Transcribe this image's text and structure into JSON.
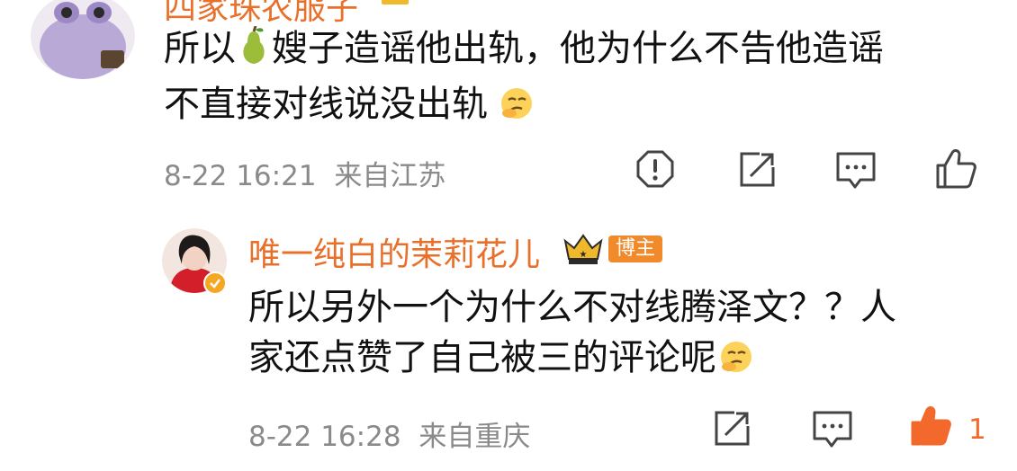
{
  "comment1": {
    "username": "四家珠农服子",
    "text_line1_a": "所以",
    "text_line1_b": "嫂子造谣他出轨，他为什么不告他造谣",
    "text_line2": "不直接对线说没出轨",
    "time": "8-22 16:21",
    "location": "来自江苏"
  },
  "reply": {
    "username": "唯一纯白的茉莉花儿",
    "badge": "博主",
    "text_line1": "所以另外一个为什么不对线腾泽文？？人",
    "text_line2": "家还点赞了自己被三的评论呢",
    "time": "8-22 16:28",
    "location": "来自重庆",
    "like_count": "1"
  },
  "colors": {
    "accent": "#e8702a",
    "meta": "#8a8a8a",
    "icon": "#444444"
  },
  "icons": [
    "report-icon",
    "share-icon",
    "comment-icon",
    "like-icon",
    "pear-emoji",
    "thinking-emoji",
    "vip-crown-icon"
  ]
}
